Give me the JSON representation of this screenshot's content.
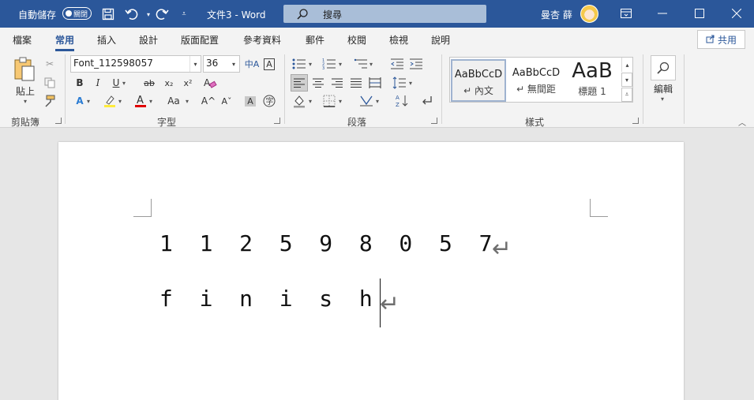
{
  "titlebar": {
    "autosave_label": "自動儲存",
    "autosave_state": "關閉",
    "document_title": "文件3 - Word",
    "search_placeholder": "搜尋",
    "user_name": "曼杏 薛",
    "accent_color": "#2b579a"
  },
  "tabs": [
    {
      "label": "檔案"
    },
    {
      "label": "常用"
    },
    {
      "label": "插入"
    },
    {
      "label": "設計"
    },
    {
      "label": "版面配置"
    },
    {
      "label": "參考資料"
    },
    {
      "label": "郵件"
    },
    {
      "label": "校閱"
    },
    {
      "label": "檢視"
    },
    {
      "label": "說明"
    }
  ],
  "active_tab": "常用",
  "share_label": "共用",
  "ribbon": {
    "clipboard": {
      "paste_label": "貼上",
      "group_label": "剪貼簿"
    },
    "font": {
      "font_name": "Font_112598057",
      "font_size": "36",
      "group_label": "字型",
      "bold": "B",
      "italic": "I",
      "underline": "U",
      "strike": "ab",
      "subscript": "x₂",
      "superscript": "x²",
      "change_case": "Aa",
      "grow": "A^",
      "shrink": "Aˇ"
    },
    "paragraph": {
      "group_label": "段落"
    },
    "styles": {
      "group_label": "樣式",
      "items": [
        {
          "sample": "AaBbCcD",
          "name": "↵ 內文"
        },
        {
          "sample": "AaBbCcD",
          "name": "↵ 無間距"
        },
        {
          "sample": "AaB",
          "name": "標題 1"
        }
      ]
    },
    "editing": {
      "label": "編輯"
    }
  },
  "document": {
    "lines": [
      "1  1  2  5  9  8  0  5  7",
      "f  i  n  i  s  h"
    ],
    "paragraph_mark": "↵"
  }
}
